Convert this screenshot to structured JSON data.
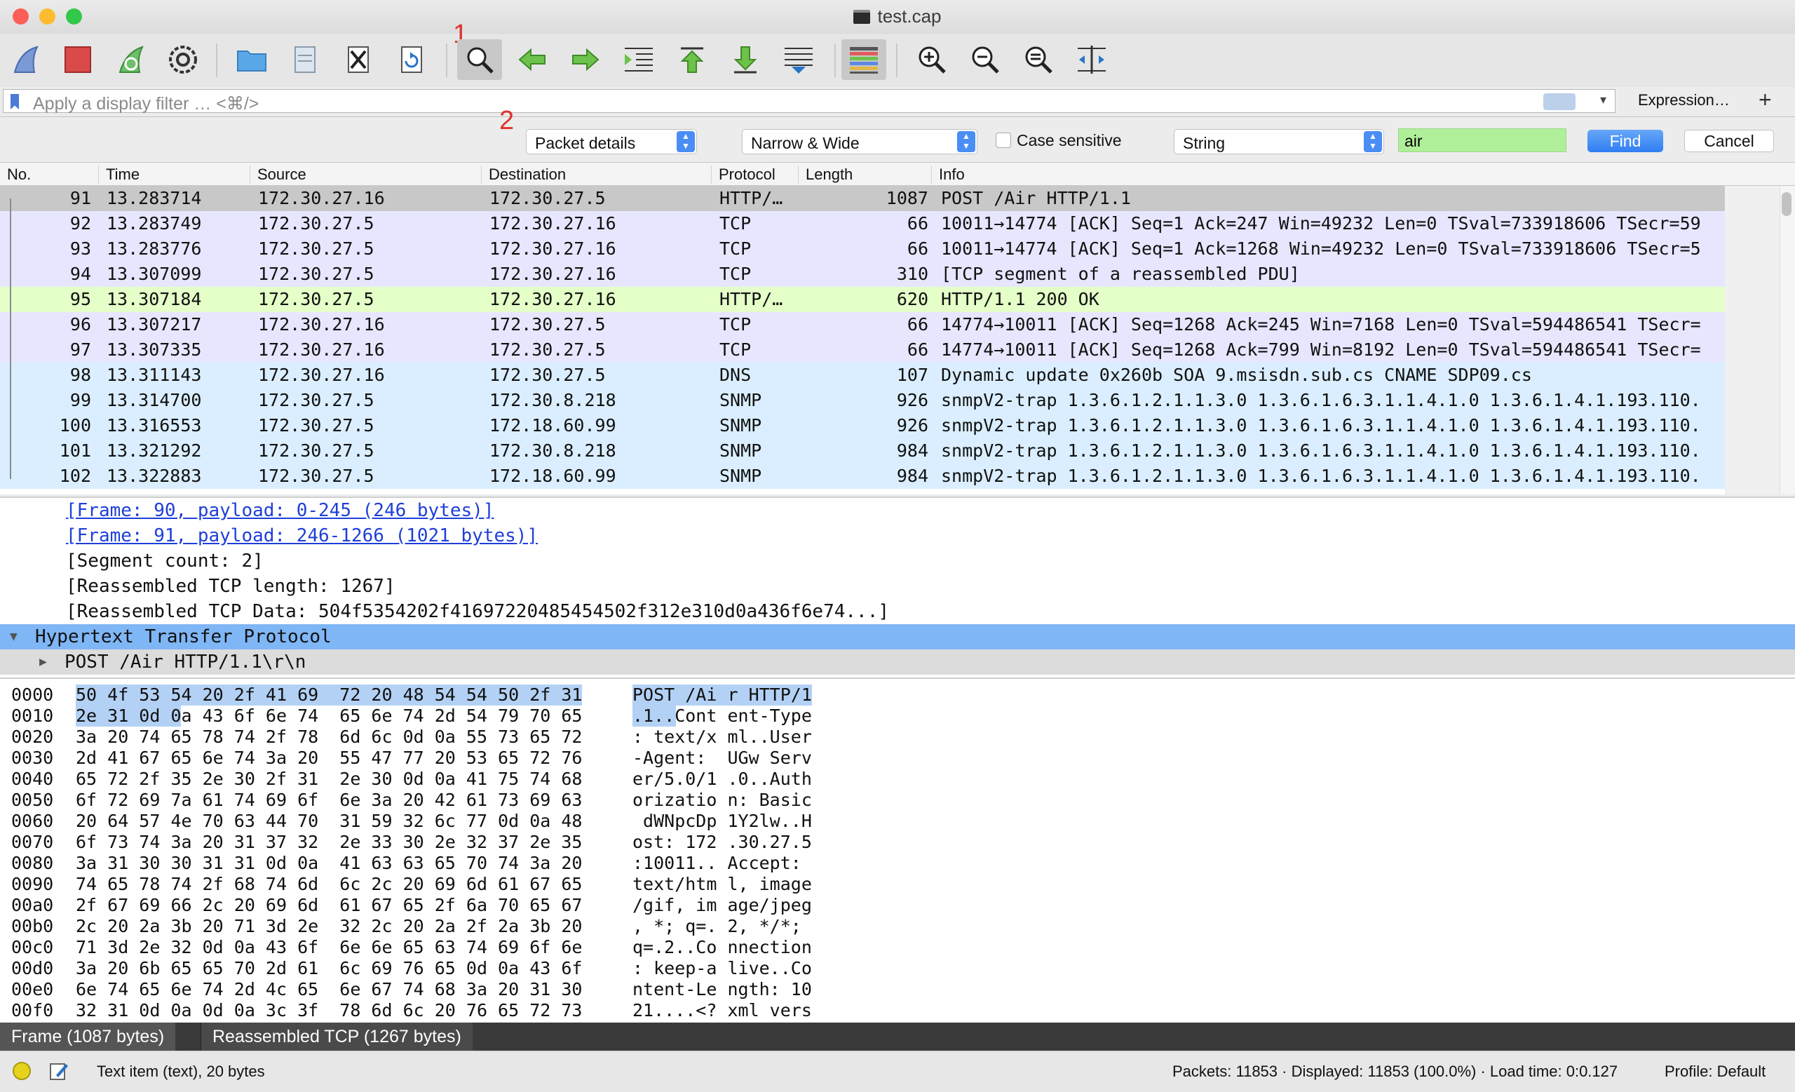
{
  "window": {
    "title": "test.cap",
    "colors": {
      "close": "#fc5f57",
      "minimize": "#fdbc2e",
      "maximize": "#34c84a"
    }
  },
  "toolbar": {
    "icons": [
      "shark-fin-start-icon",
      "stop-square-icon",
      "restart-fin-icon",
      "capture-options-gear-icon",
      "open-folder-icon",
      "save-file-icon",
      "close-file-icon",
      "reload-icon",
      "find-packet-icon",
      "go-back-arrow-icon",
      "go-forward-arrow-icon",
      "go-to-packet-icon",
      "first-packet-icon",
      "last-packet-icon",
      "autoscroll-icon",
      "colorize-icon",
      "zoom-in-icon",
      "zoom-out-icon",
      "normal-size-icon",
      "resize-columns-icon"
    ],
    "annotation_1": "1",
    "annotation_2": "2"
  },
  "filter": {
    "placeholder": "Apply a display filter … <⌘/>",
    "expression_label": "Expression…",
    "add_label": "+"
  },
  "findbar": {
    "search_in": "Packet details",
    "char_width": "Narrow & Wide",
    "case_sensitive_label": "Case sensitive",
    "search_type": "String",
    "search_value": "air",
    "find_label": "Find",
    "cancel_label": "Cancel"
  },
  "packet_list": {
    "columns": [
      "No.",
      "Time",
      "Source",
      "Destination",
      "Protocol",
      "Length",
      "Info"
    ],
    "rows": [
      {
        "no": "91",
        "time": "13.283714",
        "src": "172.30.27.16",
        "dst": "172.30.27.5",
        "proto": "HTTP/…",
        "len": "1087",
        "info": "POST /Air HTTP/1.1",
        "bg": "#c8c8c8"
      },
      {
        "no": "92",
        "time": "13.283749",
        "src": "172.30.27.5",
        "dst": "172.30.27.16",
        "proto": "TCP",
        "len": "66",
        "info": "10011→14774 [ACK] Seq=1 Ack=247 Win=49232 Len=0 TSval=733918606 TSecr=59",
        "bg": "#e7e6ff"
      },
      {
        "no": "93",
        "time": "13.283776",
        "src": "172.30.27.5",
        "dst": "172.30.27.16",
        "proto": "TCP",
        "len": "66",
        "info": "10011→14774 [ACK] Seq=1 Ack=1268 Win=49232 Len=0 TSval=733918606 TSecr=5",
        "bg": "#e7e6ff"
      },
      {
        "no": "94",
        "time": "13.307099",
        "src": "172.30.27.5",
        "dst": "172.30.27.16",
        "proto": "TCP",
        "len": "310",
        "info": "[TCP segment of a reassembled PDU]",
        "bg": "#e7e6ff"
      },
      {
        "no": "95",
        "time": "13.307184",
        "src": "172.30.27.5",
        "dst": "172.30.27.16",
        "proto": "HTTP/…",
        "len": "620",
        "info": "HTTP/1.1 200 OK",
        "bg": "#e4ffc7"
      },
      {
        "no": "96",
        "time": "13.307217",
        "src": "172.30.27.16",
        "dst": "172.30.27.5",
        "proto": "TCP",
        "len": "66",
        "info": "14774→10011 [ACK] Seq=1268 Ack=245 Win=7168 Len=0 TSval=594486541 TSecr=",
        "bg": "#e7e6ff"
      },
      {
        "no": "97",
        "time": "13.307335",
        "src": "172.30.27.16",
        "dst": "172.30.27.5",
        "proto": "TCP",
        "len": "66",
        "info": "14774→10011 [ACK] Seq=1268 Ack=799 Win=8192 Len=0 TSval=594486541 TSecr=",
        "bg": "#e7e6ff"
      },
      {
        "no": "98",
        "time": "13.311143",
        "src": "172.30.27.16",
        "dst": "172.30.27.5",
        "proto": "DNS",
        "len": "107",
        "info": "Dynamic update 0x260b SOA 9.msisdn.sub.cs CNAME SDP09.cs",
        "bg": "#daeeff"
      },
      {
        "no": "99",
        "time": "13.314700",
        "src": "172.30.27.5",
        "dst": "172.30.8.218",
        "proto": "SNMP",
        "len": "926",
        "info": "snmpV2-trap 1.3.6.1.2.1.1.3.0 1.3.6.1.6.3.1.1.4.1.0 1.3.6.1.4.1.193.110.",
        "bg": "#daeeff"
      },
      {
        "no": "100",
        "time": "13.316553",
        "src": "172.30.27.5",
        "dst": "172.18.60.99",
        "proto": "SNMP",
        "len": "926",
        "info": "snmpV2-trap 1.3.6.1.2.1.1.3.0 1.3.6.1.6.3.1.1.4.1.0 1.3.6.1.4.1.193.110.",
        "bg": "#daeeff"
      },
      {
        "no": "101",
        "time": "13.321292",
        "src": "172.30.27.5",
        "dst": "172.30.8.218",
        "proto": "SNMP",
        "len": "984",
        "info": "snmpV2-trap 1.3.6.1.2.1.1.3.0 1.3.6.1.6.3.1.1.4.1.0 1.3.6.1.4.1.193.110.",
        "bg": "#daeeff"
      },
      {
        "no": "102",
        "time": "13.322883",
        "src": "172.30.27.5",
        "dst": "172.18.60.99",
        "proto": "SNMP",
        "len": "984",
        "info": "snmpV2-trap 1.3.6.1.2.1.1.3.0 1.3.6.1.6.3.1.1.4.1.0 1.3.6.1.4.1.193.110.",
        "bg": "#daeeff"
      }
    ]
  },
  "details": {
    "frame90": "[Frame: 90, payload: 0-245 (246 bytes)]",
    "frame91": "[Frame: 91, payload: 246-1266 (1021 bytes)]",
    "segcount": "[Segment count: 2]",
    "reasm_len": "[Reassembled TCP length: 1267]",
    "reasm_data": "[Reassembled TCP Data: 504f5354202f41697220485454502f312e310d0a436f6e74...]",
    "http": "Hypertext Transfer Protocol",
    "post": "POST /Air HTTP/1.1\\r\\n",
    "highlight_color": "#7fb6f5"
  },
  "bytes": [
    {
      "off": "0000",
      "hex": "50 4f 53 54 20 2f 41 69  72 20 48 54 54 50 2f 31",
      "asc": "POST /Ai r HTTP/1"
    },
    {
      "off": "0010",
      "hex": "2e 31 0d 0a 43 6f 6e 74  65 6e 74 2d 54 79 70 65",
      "asc": ".1..Cont ent-Type"
    },
    {
      "off": "0020",
      "hex": "3a 20 74 65 78 74 2f 78  6d 6c 0d 0a 55 73 65 72",
      "asc": ": text/x ml..User"
    },
    {
      "off": "0030",
      "hex": "2d 41 67 65 6e 74 3a 20  55 47 77 20 53 65 72 76",
      "asc": "-Agent:  UGw Serv"
    },
    {
      "off": "0040",
      "hex": "65 72 2f 35 2e 30 2f 31  2e 30 0d 0a 41 75 74 68",
      "asc": "er/5.0/1 .0..Auth"
    },
    {
      "off": "0050",
      "hex": "6f 72 69 7a 61 74 69 6f  6e 3a 20 42 61 73 69 63",
      "asc": "orizatio n: Basic"
    },
    {
      "off": "0060",
      "hex": "20 64 57 4e 70 63 44 70  31 59 32 6c 77 0d 0a 48",
      "asc": " dWNpcDp 1Y2lw..H"
    },
    {
      "off": "0070",
      "hex": "6f 73 74 3a 20 31 37 32  2e 33 30 2e 32 37 2e 35",
      "asc": "ost: 172 .30.27.5"
    },
    {
      "off": "0080",
      "hex": "3a 31 30 30 31 31 0d 0a  41 63 63 65 70 74 3a 20",
      "asc": ":10011.. Accept: "
    },
    {
      "off": "0090",
      "hex": "74 65 78 74 2f 68 74 6d  6c 2c 20 69 6d 61 67 65",
      "asc": "text/htm l, image"
    },
    {
      "off": "00a0",
      "hex": "2f 67 69 66 2c 20 69 6d  61 67 65 2f 6a 70 65 67",
      "asc": "/gif, im age/jpeg"
    },
    {
      "off": "00b0",
      "hex": "2c 20 2a 3b 20 71 3d 2e  32 2c 20 2a 2f 2a 3b 20",
      "asc": ", *; q=. 2, */*; "
    },
    {
      "off": "00c0",
      "hex": "71 3d 2e 32 0d 0a 43 6f  6e 6e 65 63 74 69 6f 6e",
      "asc": "q=.2..Co nnection"
    },
    {
      "off": "00d0",
      "hex": "3a 20 6b 65 65 70 2d 61  6c 69 76 65 0d 0a 43 6f",
      "asc": ": keep-a live..Co"
    },
    {
      "off": "00e0",
      "hex": "6e 74 65 6e 74 2d 4c 65  6e 67 74 68 3a 20 31 30",
      "asc": "ntent-Le ngth: 10"
    },
    {
      "off": "00f0",
      "hex": "32 31 0d 0a 0d 0a 3c 3f  78 6d 6c 20 76 65 72 73",
      "asc": "21....<? xml vers"
    }
  ],
  "tabs": {
    "frame": "Frame (1087 bytes)",
    "reassembled": "Reassembled TCP (1267 bytes)"
  },
  "status": {
    "item": "Text item (text), 20 bytes",
    "packets": "Packets: 11853 · Displayed: 11853 (100.0%) · Load time: 0:0.127",
    "profile": "Profile: Default"
  }
}
